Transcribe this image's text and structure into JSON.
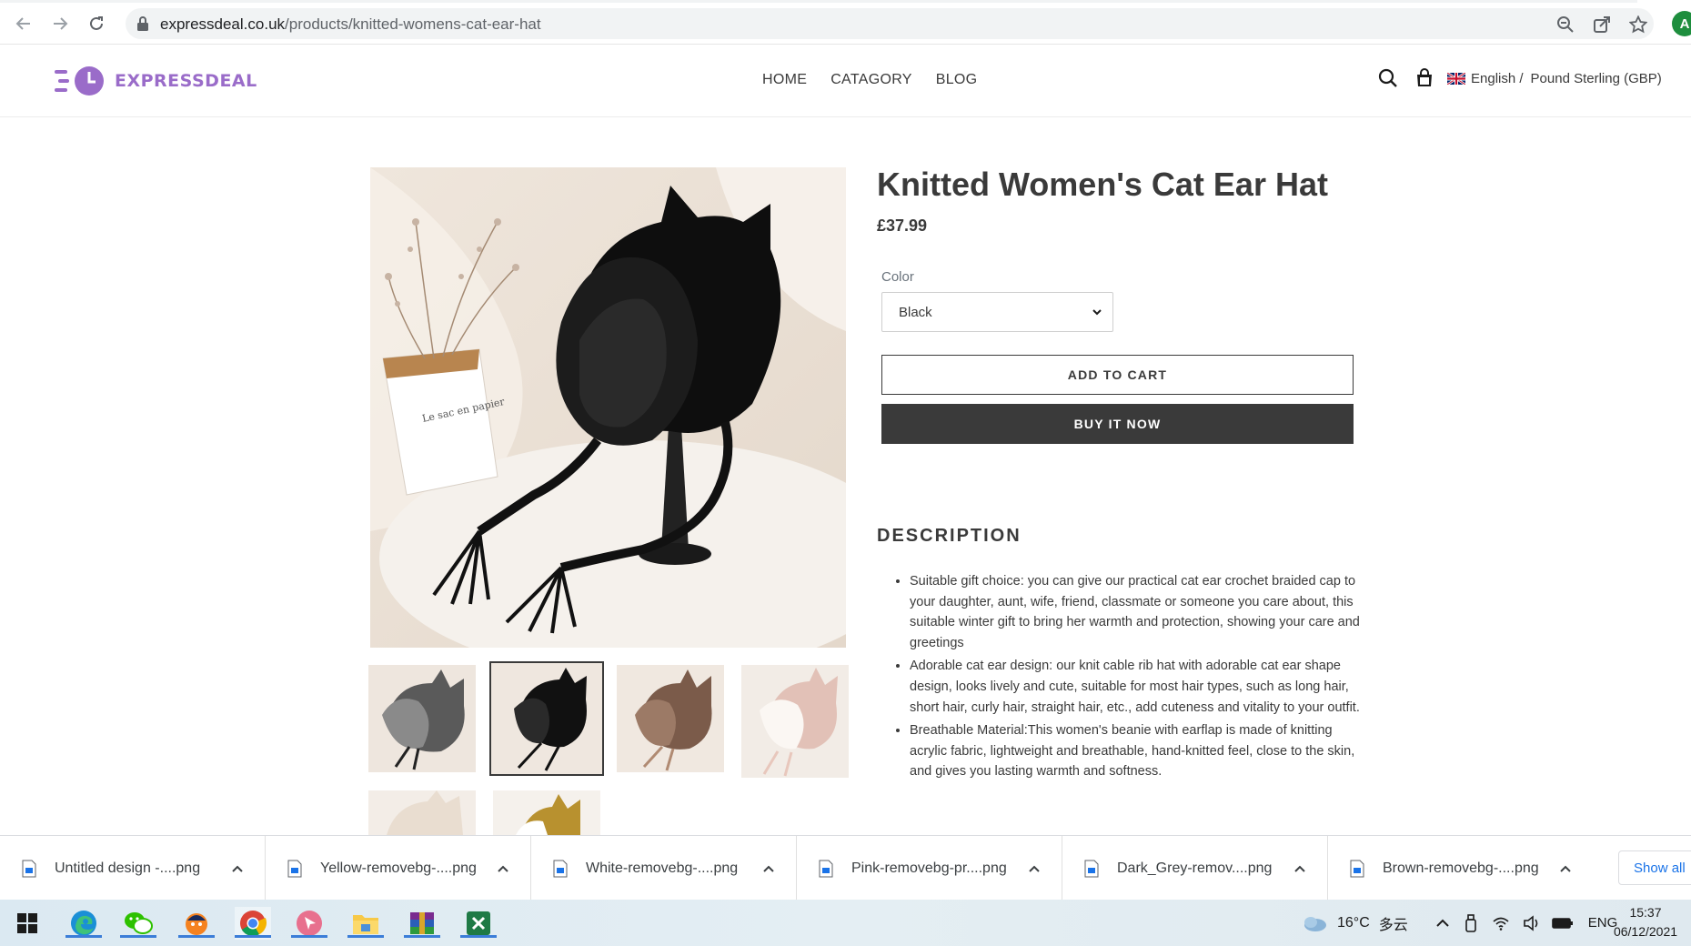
{
  "browser": {
    "url_domain": "expressdeal.co.uk",
    "url_path": "/products/knitted-womens-cat-ear-hat",
    "profile_initial": "A"
  },
  "site": {
    "logo_text": "EXPRESSDEAL",
    "nav": [
      "HOME",
      "CATAGORY",
      "BLOG"
    ],
    "language": "English /",
    "currency": "Pound Sterling (GBP)"
  },
  "product": {
    "title": "Knitted Women's Cat Ear Hat",
    "price": "£37.99",
    "color_label": "Color",
    "color_value": "Black",
    "add_to_cart": "ADD TO CART",
    "buy_now": "BUY IT NOW",
    "description_title": "DESCRIPTION",
    "description": [
      "Suitable gift choice: you can give our practical cat ear crochet braided cap to your daughter, aunt, wife, friend, classmate or someone you care about, this suitable winter gift to bring her warmth and protection, showing your care and greetings",
      "Adorable cat ear design: our knit cable rib hat with adorable cat ear shape design, looks lively and cute, suitable for most hair types, such as long hair, short hair, curly hair, straight hair, etc., add cuteness and vitality to your outfit.",
      "Breathable Material:This women's beanie with earflap is made of knitting acrylic fabric, lightweight and breathable, hand-knitted feel, close to the skin, and gives you lasting warmth and softness."
    ],
    "main_image_text": "Le sac en papier"
  },
  "downloads": {
    "items": [
      "Untitled design -....png",
      "Yellow-removebg-....png",
      "White-removebg-....png",
      "Pink-removebg-pr....png",
      "Dark_Grey-remov....png",
      "Brown-removebg-....png"
    ],
    "show_all": "Show all"
  },
  "taskbar": {
    "temperature": "16°C",
    "weather": "多云",
    "input_lang": "ENG",
    "time": "15:37",
    "date": "06/12/2021"
  },
  "colors": {
    "brand": "#9a6cc9",
    "dark": "#3a3a3a",
    "link": "#1a73e8"
  }
}
